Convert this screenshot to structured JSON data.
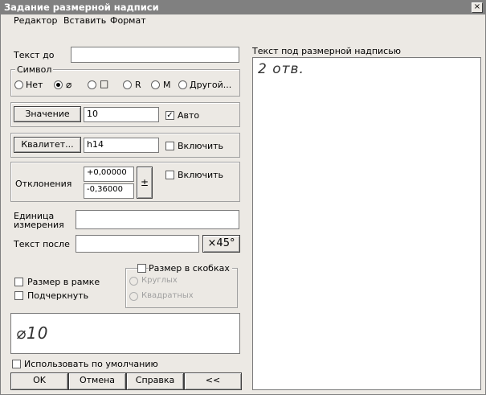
{
  "window": {
    "title": "Задание размерной надписи",
    "close_glyph": "×"
  },
  "menu": [
    {
      "label": "Редактор"
    },
    {
      "label": "Вставить"
    },
    {
      "label": "Формат"
    }
  ],
  "text_before": {
    "label": "Текст до",
    "value": ""
  },
  "symbol": {
    "legend": "Символ",
    "options": [
      {
        "label": "Нет",
        "selected": false
      },
      {
        "label": "⌀",
        "selected": true
      },
      {
        "label": "□",
        "selected": false
      },
      {
        "label": "R",
        "selected": false
      },
      {
        "label": "M",
        "selected": false
      },
      {
        "label": "Другой...",
        "selected": false
      }
    ]
  },
  "value": {
    "button": "Значение",
    "field": "10",
    "auto_label": "Авто",
    "auto_checked": true
  },
  "quality": {
    "button": "Квалитет...",
    "field": "h14",
    "include_label": "Включить",
    "include_checked": false
  },
  "deviations": {
    "label": "Отклонения",
    "upper": "+0,00000",
    "lower": "-0,36000",
    "pm": "±",
    "include_label": "Включить",
    "include_checked": false
  },
  "unit": {
    "label": "Единица измерения",
    "value": ""
  },
  "text_after": {
    "label": "Текст после",
    "value": "",
    "x45": "×45°"
  },
  "frame": {
    "label": "Размер в рамке",
    "checked": false
  },
  "underline": {
    "label": "Подчеркнуть",
    "checked": false
  },
  "brackets": {
    "label": "Размер в скобках",
    "checked": false,
    "round": "Круглых",
    "square": "Квадратных"
  },
  "preview": {
    "text": "⌀10"
  },
  "use_default": {
    "label": "Использовать по умолчанию",
    "checked": false
  },
  "buttons": {
    "ok": "OK",
    "cancel": "Отмена",
    "help": "Справка",
    "collapse": "<<"
  },
  "under_text": {
    "label": "Текст под размерной надписью",
    "value": "2 отв."
  }
}
